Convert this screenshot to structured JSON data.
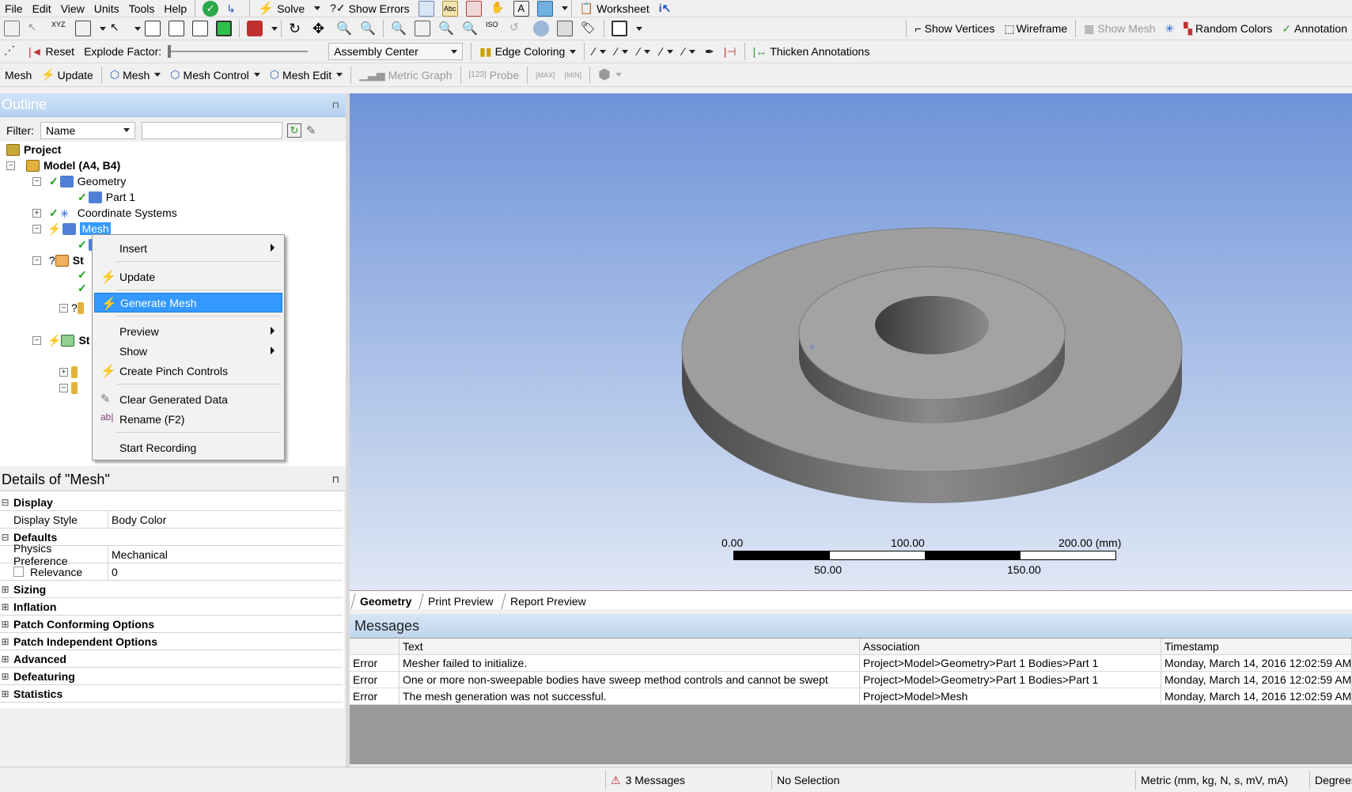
{
  "menu": [
    "File",
    "Edit",
    "View",
    "Units",
    "Tools",
    "Help"
  ],
  "toolbar1": {
    "solve": "Solve",
    "show_errors": "Show Errors",
    "worksheet": "Worksheet"
  },
  "toolbar2": {
    "show_vertices": "Show Vertices",
    "wireframe": "Wireframe",
    "show_mesh": "Show Mesh",
    "random_colors": "Random Colors",
    "annotation": "Annotation"
  },
  "toolbar3": {
    "reset": "Reset",
    "explode_factor": "Explode Factor:",
    "assembly_center": "Assembly Center",
    "edge_coloring": "Edge Coloring",
    "thicken_annotations": "Thicken Annotations"
  },
  "toolbar4": {
    "mesh": "Mesh",
    "update": "Update",
    "mesh_dd": "Mesh",
    "mesh_control": "Mesh Control",
    "mesh_edit": "Mesh Edit",
    "metric_graph": "Metric Graph",
    "probe": "Probe"
  },
  "outline": {
    "title": "Outline",
    "filter_label": "Filter:",
    "filter_value": "Name",
    "tree": {
      "project": "Project",
      "model": "Model (A4, B4)",
      "geometry": "Geometry",
      "part1": "Part 1",
      "coordinate_systems": "Coordinate Systems",
      "mesh": "Mesh",
      "st1": "St",
      "st2": "St"
    }
  },
  "context_menu": {
    "insert": "Insert",
    "update": "Update",
    "generate_mesh": "Generate Mesh",
    "preview": "Preview",
    "show": "Show",
    "create_pinch": "Create Pinch Controls",
    "clear_generated": "Clear Generated Data",
    "rename": "Rename (F2)",
    "start_recording": "Start Recording"
  },
  "details": {
    "title": "Details of \"Mesh\"",
    "display": "Display",
    "display_style_k": "Display Style",
    "display_style_v": "Body Color",
    "defaults": "Defaults",
    "physics_k": "Physics Preference",
    "physics_v": "Mechanical",
    "relevance_k": "Relevance",
    "relevance_v": "0",
    "sizing": "Sizing",
    "inflation": "Inflation",
    "patch_conf": "Patch Conforming Options",
    "patch_indep": "Patch Independent Options",
    "advanced": "Advanced",
    "defeaturing": "Defeaturing",
    "statistics": "Statistics"
  },
  "scale": {
    "t0": "0.00",
    "t100": "100.00",
    "t200": "200.00 (mm)",
    "t50": "50.00",
    "t150": "150.00"
  },
  "tabs": [
    "Geometry",
    "Print Preview",
    "Report Preview"
  ],
  "messages": {
    "title": "Messages",
    "headers": [
      "",
      "Text",
      "Association",
      "Timestamp"
    ],
    "rows": [
      [
        "Error",
        "Mesher failed to initialize.",
        "Project>Model>Geometry>Part 1 Bodies>Part 1",
        "Monday, March 14, 2016 12:02:59 AM"
      ],
      [
        "Error",
        "One or more non-sweepable bodies have sweep method controls and cannot be swept",
        "Project>Model>Geometry>Part 1 Bodies>Part 1",
        "Monday, March 14, 2016 12:02:59 AM"
      ],
      [
        "Error",
        "The mesh generation was not successful.",
        "Project>Model>Mesh",
        "Monday, March 14, 2016 12:02:59 AM"
      ]
    ]
  },
  "status": {
    "messages": "3 Messages",
    "selection": "No Selection",
    "units": "Metric (mm, kg, N, s, mV, mA)",
    "degrees": "Degrees"
  }
}
